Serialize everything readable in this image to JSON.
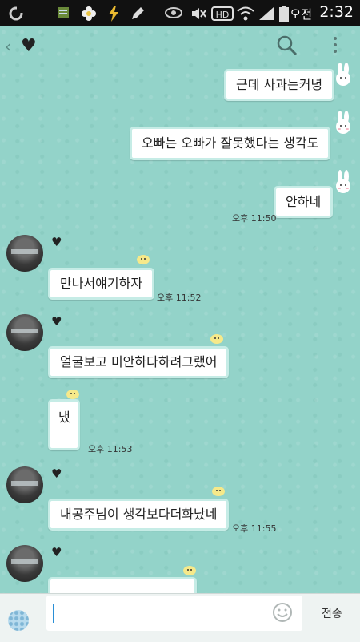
{
  "status_bar": {
    "ampm": "오전",
    "time": "2:32",
    "icons": [
      "refresh-icon",
      "notes-icon",
      "flower-icon",
      "bolt-icon",
      "pencil-icon",
      "eye-icon",
      "mute-icon",
      "hd-icon",
      "wifi-icon",
      "signal-icon",
      "battery-icon"
    ]
  },
  "header": {
    "back_icon": "chevron-left-icon",
    "title_icon": "heart-icon",
    "search_icon": "search-icon",
    "more_icon": "more-vertical-icon"
  },
  "messages": [
    {
      "side": "right",
      "text": "근데 사과는커녕",
      "sticker": "bunny"
    },
    {
      "side": "right",
      "text": "오빠는 오빠가 잘못했다는 생각도",
      "sticker": "bunny"
    },
    {
      "side": "right",
      "text": "안하네",
      "time": "오후 11:50",
      "sticker": "bunny"
    },
    {
      "side": "left",
      "sender_icon": "heart-icon",
      "text": "만나서얘기하자",
      "time": "오후 11:52",
      "sticker": "chick"
    },
    {
      "side": "left",
      "sender_icon": "heart-icon",
      "text": "얼굴보고 미안하다하려그랬어",
      "sticker": "chick"
    },
    {
      "side": "left",
      "text": "냈",
      "time": "오후 11:53",
      "sticker": "chick"
    },
    {
      "side": "left",
      "sender_icon": "heart-icon",
      "text": "내공주님이 생각보다더화났네",
      "time": "오후 11:55",
      "sticker": "chick"
    },
    {
      "side": "left",
      "sender_icon": "heart-icon",
      "text": "",
      "sticker": "chick"
    }
  ],
  "input": {
    "value": "",
    "placeholder": "",
    "send_label": "전송"
  },
  "colors": {
    "background": "#93d3c9",
    "bubble": "#ffffff",
    "bubble_border": "#c6ece6",
    "caret": "#2a8fd6"
  }
}
